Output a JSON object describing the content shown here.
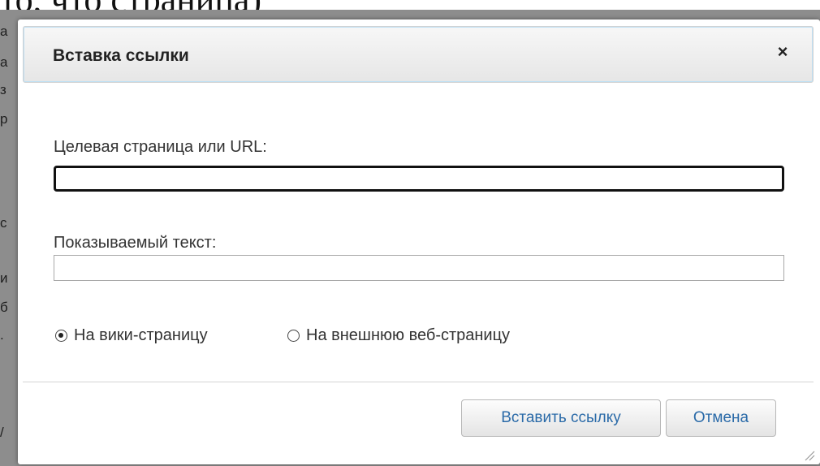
{
  "background": {
    "top_text": "то, что страница)",
    "side_letters": [
      "а",
      "а",
      "з",
      "р",
      "с",
      "и",
      "б",
      ".",
      "/"
    ]
  },
  "dialog": {
    "title": "Вставка ссылки",
    "close_symbol": "×",
    "url_label": "Целевая страница или URL:",
    "url_value": "",
    "text_label": "Показываемый текст:",
    "text_value": "",
    "radio_options": [
      {
        "label": "На вики-страницу",
        "checked": true
      },
      {
        "label": "На внешнюю веб-страницу",
        "checked": false
      }
    ],
    "insert_button": "Вставить ссылку",
    "cancel_button": "Отмена"
  },
  "icons": {
    "close": "close-icon",
    "resize": "resize-grip-icon"
  },
  "colors": {
    "button_text": "#2a6aa8",
    "overlay": "#8d8d8d"
  }
}
